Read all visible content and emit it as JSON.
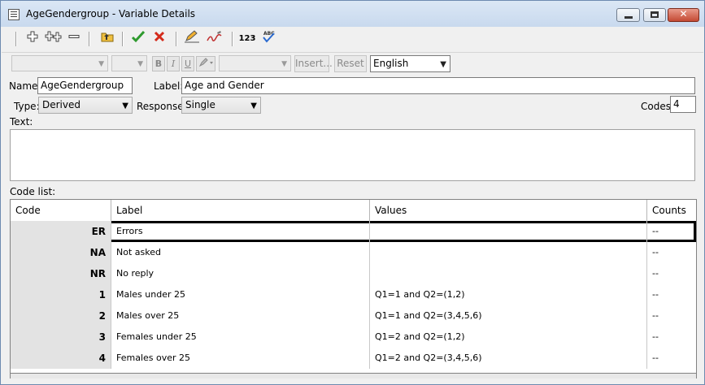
{
  "window": {
    "title": "AgeGendergroup - Variable Details",
    "close_glyph": "✕"
  },
  "toolbar": {
    "add_icon": "+",
    "add_multiple_icon": "+++",
    "remove_icon": "—",
    "numbering_icon": "123"
  },
  "format_bar": {
    "bold": "B",
    "italic": "I",
    "underline": "U",
    "insert_label": "Insert...",
    "reset_label": "Reset",
    "language_value": "English"
  },
  "form": {
    "name_label": "Name:",
    "name_value": "AgeGendergroup",
    "label_label": "Label:",
    "label_value": "Age and Gender",
    "type_label": "Type:",
    "type_value": "Derived",
    "response_label": "Response:",
    "response_value": "Single",
    "codes_label": "Codes:",
    "codes_value": "4",
    "text_label": "Text:",
    "code_list_label": "Code list:"
  },
  "grid": {
    "columns": [
      "Code",
      "Label",
      "Values",
      "Counts"
    ],
    "rows": [
      {
        "code": "ER",
        "label": "Errors",
        "values": "",
        "counts": "--"
      },
      {
        "code": "NA",
        "label": "Not asked",
        "values": "",
        "counts": "--"
      },
      {
        "code": "NR",
        "label": "No reply",
        "values": "",
        "counts": "--"
      },
      {
        "code": "1",
        "label": "Males under 25",
        "values": "Q1=1 and Q2=(1,2)",
        "counts": "--"
      },
      {
        "code": "2",
        "label": "Males over 25",
        "values": "Q1=1 and Q2=(3,4,5,6)",
        "counts": "--"
      },
      {
        "code": "3",
        "label": "Females under 25",
        "values": "Q1=2 and Q2=(1,2)",
        "counts": "--"
      },
      {
        "code": "4",
        "label": "Females over 25",
        "values": "Q1=2 and Q2=(3,4,5,6)",
        "counts": "--"
      }
    ]
  },
  "colors": {
    "accept": "#2e9a2e",
    "reject": "#d42a1a",
    "titlebar": "#c8d9ee"
  }
}
